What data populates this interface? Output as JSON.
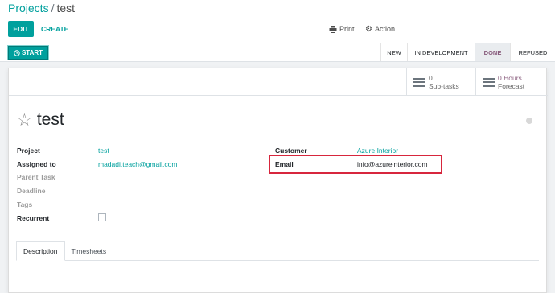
{
  "breadcrumb": {
    "parent": "Projects",
    "separator": "/",
    "current": "test"
  },
  "toolbar": {
    "edit_label": "EDIT",
    "create_label": "CREATE",
    "print_label": "Print",
    "action_label": "Action"
  },
  "statusbar": {
    "start_label": "START",
    "stages": [
      "NEW",
      "IN DEVELOPMENT",
      "DONE",
      "REFUSED"
    ],
    "active_stage": "DONE"
  },
  "stats": {
    "subtasks": {
      "value": "0",
      "label": "Sub-tasks"
    },
    "hours": {
      "value": "0",
      "unit": "Hours",
      "label": "Forecast"
    }
  },
  "task": {
    "title": "test",
    "fields_left": {
      "project_label": "Project",
      "project_value": "test",
      "assigned_label": "Assigned to",
      "assigned_value": "madadi.teach@gmail.com",
      "parent_label": "Parent Task",
      "deadline_label": "Deadline",
      "tags_label": "Tags",
      "recurrent_label": "Recurrent"
    },
    "fields_right": {
      "customer_label": "Customer",
      "customer_value": "Azure Interior",
      "email_label": "Email",
      "email_value": "info@azureinterior.com"
    }
  },
  "tabs": [
    {
      "label": "Description"
    },
    {
      "label": "Timesheets"
    }
  ],
  "colors": {
    "primary": "#00a09d",
    "stage_done": "#875a7b",
    "highlight": "#d7263d"
  }
}
